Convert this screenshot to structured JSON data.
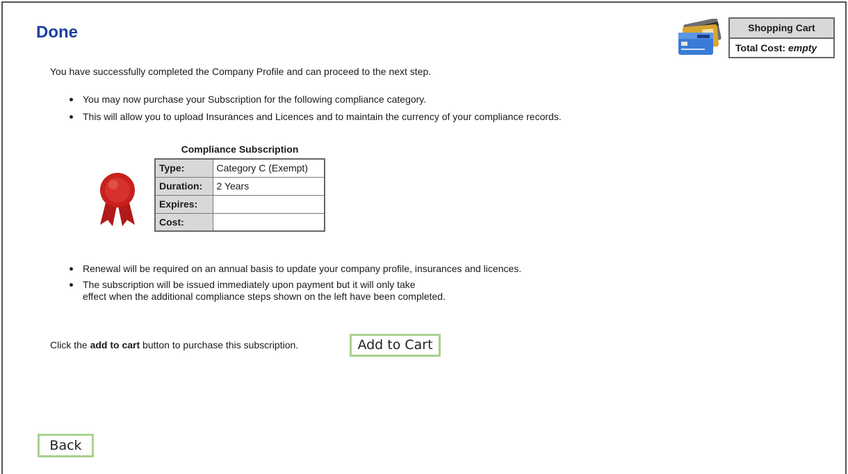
{
  "page": {
    "title": "Done",
    "intro": "You have successfully completed the Company Profile and can proceed to the next step."
  },
  "bullets_top": [
    "You may now purchase your Subscription for the following compliance category.",
    "This will allow you to upload Insurances and Licences and to maintain the currency of your compliance records."
  ],
  "subscription": {
    "caption": "Compliance Subscription",
    "rows": [
      {
        "label": "Type:",
        "value": "Category C (Exempt)"
      },
      {
        "label": "Duration:",
        "value": "2 Years"
      },
      {
        "label": "Expires:",
        "value": ""
      },
      {
        "label": "Cost:",
        "value": ""
      }
    ],
    "seal_icon": "award-ribbon-icon",
    "seal_color": "#c8201e"
  },
  "bullets_bottom": [
    "Renewal will be required on an annual basis to update your company profile, insurances and licences.",
    "The subscription will be issued immediately upon payment but it will only take",
    "effect when the additional compliance steps shown on the left have been completed."
  ],
  "cta": {
    "prefix": "Click the ",
    "bold": "add to cart",
    "suffix": " button to purchase this subscription.",
    "button_label": "Add to Cart"
  },
  "back_label": "Back",
  "cart": {
    "heading": "Shopping Cart",
    "total_label": "Total Cost:",
    "total_value": "empty",
    "icon": "credit-cards-icon"
  },
  "colors": {
    "title": "#1c3fa0",
    "button_border": "#a9d28f",
    "header_bg": "#d8d8d8"
  }
}
